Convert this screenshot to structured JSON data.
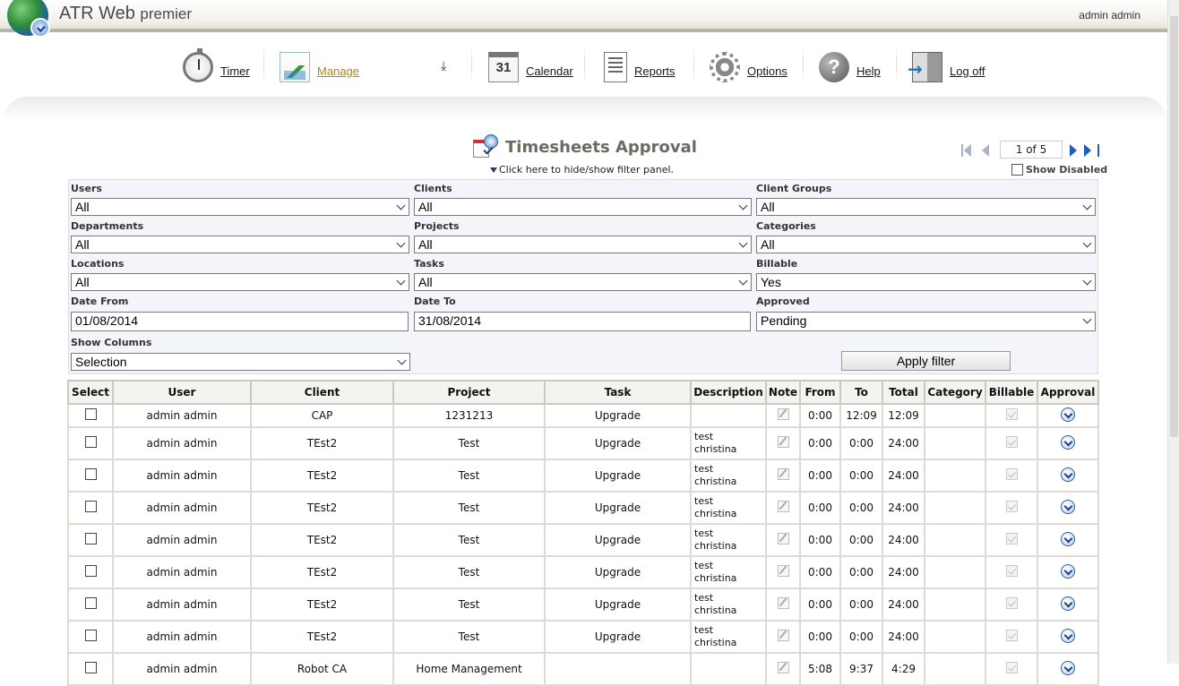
{
  "app": {
    "title": "ATR Web",
    "edition": "premier",
    "user": "admin admin"
  },
  "nav": {
    "timer": "Timer",
    "manage": "Manage",
    "calendar": "Calendar",
    "calendar_day": "31",
    "reports": "Reports",
    "options": "Options",
    "help": "Help",
    "logoff": "Log off"
  },
  "page": {
    "title": "Timesheets Approval",
    "filter_toggle": "Click here to hide/show filter panel.",
    "show_disabled": "Show Disabled"
  },
  "pager": {
    "text": "1 of 5"
  },
  "filters": {
    "users": {
      "label": "Users",
      "value": "All"
    },
    "clients": {
      "label": "Clients",
      "value": "All"
    },
    "client_groups": {
      "label": "Client Groups",
      "value": "All"
    },
    "departments": {
      "label": "Departments",
      "value": "All"
    },
    "projects": {
      "label": "Projects",
      "value": "All"
    },
    "categories": {
      "label": "Categories",
      "value": "All"
    },
    "locations": {
      "label": "Locations",
      "value": "All"
    },
    "tasks": {
      "label": "Tasks",
      "value": "All"
    },
    "billable": {
      "label": "Billable",
      "value": "Yes"
    },
    "date_from": {
      "label": "Date From",
      "value": "01/08/2014"
    },
    "date_to": {
      "label": "Date To",
      "value": "31/08/2014"
    },
    "approved": {
      "label": "Approved",
      "value": "Pending"
    },
    "show_columns": {
      "label": "Show Columns",
      "value": "Selection"
    },
    "apply": "Apply filter"
  },
  "table": {
    "columns": [
      "Select",
      "User",
      "Client",
      "Project",
      "Task",
      "Description",
      "Note",
      "From",
      "To",
      "Total",
      "Category",
      "Billable",
      "Approval"
    ],
    "rows": [
      {
        "user": "admin admin",
        "client": "CAP",
        "project": "1231213",
        "task": "Upgrade",
        "desc1": "",
        "desc2": "",
        "from": "0:00",
        "to": "12:09",
        "total": "12:09",
        "category": ""
      },
      {
        "user": "admin admin",
        "client": "TEst2",
        "project": "Test",
        "task": "Upgrade",
        "desc1": "test",
        "desc2": "christina",
        "from": "0:00",
        "to": "0:00",
        "total": "24:00",
        "category": ""
      },
      {
        "user": "admin admin",
        "client": "TEst2",
        "project": "Test",
        "task": "Upgrade",
        "desc1": "test",
        "desc2": "christina",
        "from": "0:00",
        "to": "0:00",
        "total": "24:00",
        "category": ""
      },
      {
        "user": "admin admin",
        "client": "TEst2",
        "project": "Test",
        "task": "Upgrade",
        "desc1": "test",
        "desc2": "christina",
        "from": "0:00",
        "to": "0:00",
        "total": "24:00",
        "category": ""
      },
      {
        "user": "admin admin",
        "client": "TEst2",
        "project": "Test",
        "task": "Upgrade",
        "desc1": "test",
        "desc2": "christina",
        "from": "0:00",
        "to": "0:00",
        "total": "24:00",
        "category": ""
      },
      {
        "user": "admin admin",
        "client": "TEst2",
        "project": "Test",
        "task": "Upgrade",
        "desc1": "test",
        "desc2": "christina",
        "from": "0:00",
        "to": "0:00",
        "total": "24:00",
        "category": ""
      },
      {
        "user": "admin admin",
        "client": "TEst2",
        "project": "Test",
        "task": "Upgrade",
        "desc1": "test",
        "desc2": "christina",
        "from": "0:00",
        "to": "0:00",
        "total": "24:00",
        "category": ""
      },
      {
        "user": "admin admin",
        "client": "TEst2",
        "project": "Test",
        "task": "Upgrade",
        "desc1": "test",
        "desc2": "christina",
        "from": "0:00",
        "to": "0:00",
        "total": "24:00",
        "category": ""
      },
      {
        "user": "admin admin",
        "client": "Robot CA",
        "project": "Home Management",
        "task": "",
        "desc1": "",
        "desc2": "",
        "from": "5:08",
        "to": "9:37",
        "total": "4:29",
        "category": ""
      }
    ]
  }
}
